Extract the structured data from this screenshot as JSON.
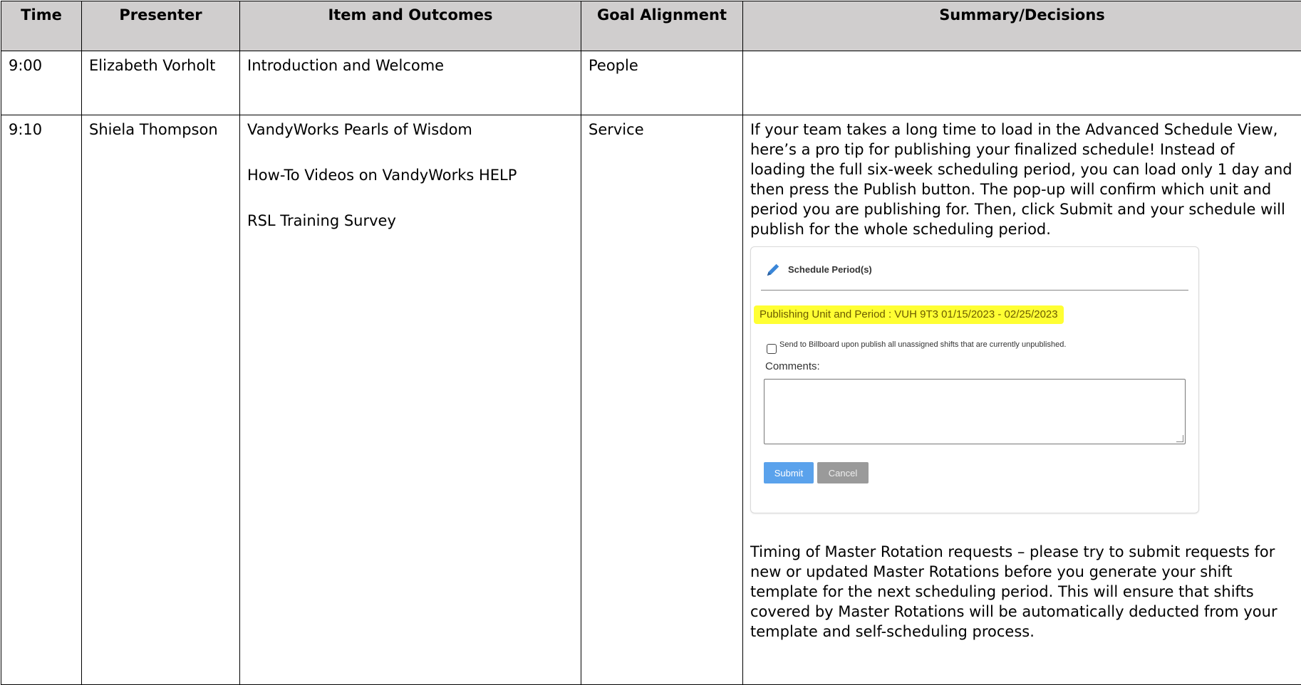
{
  "table": {
    "headers": [
      "Time",
      "Presenter",
      "Item and Outcomes",
      "Goal Alignment",
      "Summary/Decisions"
    ],
    "rows": [
      {
        "time": "9:00",
        "presenter": "Elizabeth Vorholt",
        "items": [
          "Introduction and Welcome"
        ],
        "goal": "People",
        "summary": ""
      },
      {
        "time": "9:10",
        "presenter": "Shiela Thompson",
        "items": [
          "VandyWorks Pearls of Wisdom",
          "How-To Videos on VandyWorks HELP",
          "RSL Training Survey"
        ],
        "goal": "Service",
        "summary": "If your team takes a long time to load in the Advanced Schedule View, here’s a pro tip for publishing your finalized schedule! Instead of loading the full six-week scheduling period, you can load only 1 day and then press the Publish button. The pop-up will confirm which unit and period you are publishing for. Then, click Submit and your schedule will publish for the whole scheduling period.",
        "summary2": "Timing of Master Rotation requests – please try to submit requests for new or updated Master Rotations before you generate your shift template for the next scheduling period. This will ensure that shifts covered by Master Rotations will be automatically deducted from your template and self-scheduling process."
      }
    ]
  },
  "dialog": {
    "title": "Schedule Period(s)",
    "title_icon": "pencil-icon",
    "publishing_line": "Publishing Unit and Period : VUH 9T3 01/15/2023 - 02/25/2023",
    "highlight_color": "#ffff33",
    "checkbox_label": "Send to Billboard upon publish all unassigned shifts that are currently unpublished.",
    "checkbox_checked": false,
    "comments_label": "Comments:",
    "comments_value": "",
    "submit_label": "Submit",
    "cancel_label": "Cancel",
    "submit_color": "#5aa2ec",
    "cancel_color": "#9a9a9a"
  }
}
